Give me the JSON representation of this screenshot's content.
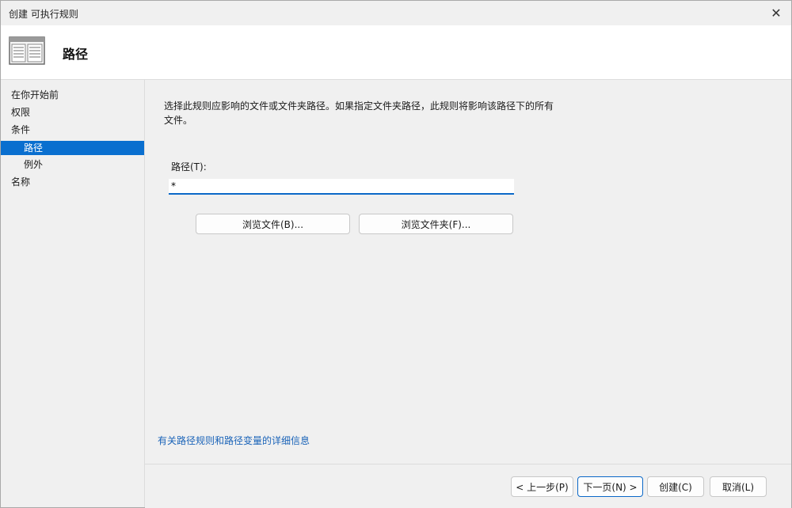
{
  "window": {
    "title": "创建 可执行规则",
    "close_glyph": "✕"
  },
  "header": {
    "title": "路径",
    "icon": "window-pages-icon"
  },
  "sidebar": {
    "items": [
      {
        "label": "在你开始前",
        "active": false
      },
      {
        "label": "权限",
        "active": false
      },
      {
        "label": "条件",
        "active": false
      },
      {
        "label": "路径",
        "active": true
      },
      {
        "label": "例外",
        "active": false
      },
      {
        "label": "名称",
        "active": false
      }
    ]
  },
  "main": {
    "description": "选择此规则应影响的文件或文件夹路径。如果指定文件夹路径，此规则将影响该路径下的所有文件。",
    "path_label": "路径(T):",
    "path_value": "*",
    "browse_files_label": "浏览文件(B)...",
    "browse_folders_label": "浏览文件夹(F)...",
    "help_link": "有关路径规则和路径变量的详细信息"
  },
  "footer": {
    "prev_label": "< 上一步(P)",
    "next_label": "下一页(N) >",
    "create_label": "创建(C)",
    "cancel_label": "取消(L)"
  },
  "colors": {
    "accent": "#0a6fcf",
    "link": "#1a63b8"
  }
}
